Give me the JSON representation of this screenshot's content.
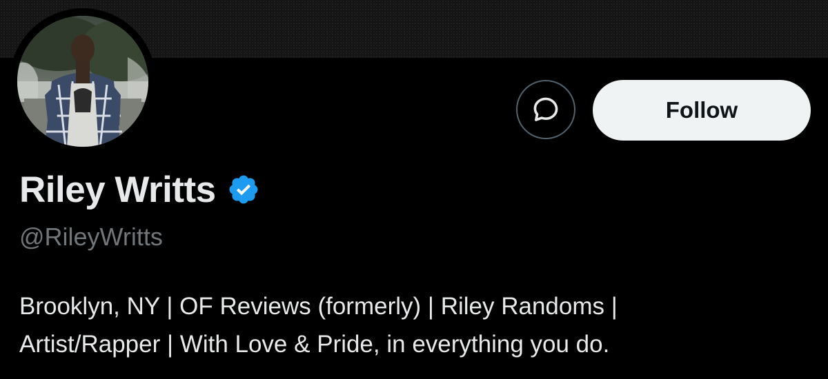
{
  "profile": {
    "display_name": "Riley Writts",
    "handle": "@RileyWritts",
    "verified": true,
    "bio_lines": [
      "Brooklyn, NY | OF Reviews (formerly) | Riley Randoms |",
      "Artist/Rapper | With Love & Pride, in everything you do."
    ]
  },
  "actions": {
    "follow_label": "Follow",
    "message_icon": "message-bubble-icon"
  },
  "colors": {
    "background": "#000000",
    "text_primary": "#e7e9ea",
    "text_secondary": "#71767b",
    "verified_blue": "#1d9bf0",
    "follow_bg": "#eff3f4",
    "follow_text": "#0f1419"
  }
}
